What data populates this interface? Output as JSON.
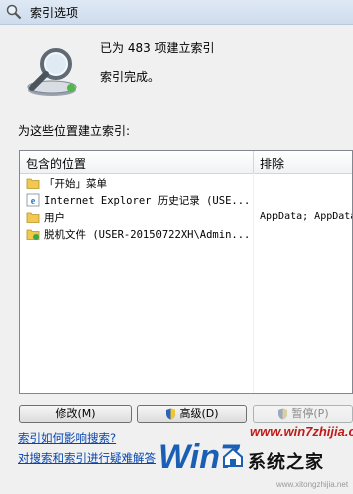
{
  "window": {
    "title": "索引选项"
  },
  "summary": {
    "count_text": "已为 483 项建立索引",
    "status_text": "索引完成。"
  },
  "locations": {
    "section_label": "为这些位置建立索引:",
    "columns": {
      "included": "包含的位置",
      "excluded": "排除"
    },
    "rows": [
      {
        "icon": "folder-icon",
        "location": "「开始」菜单",
        "exclude": ""
      },
      {
        "icon": "ie-history-icon",
        "location": "Internet Explorer 历史记录 (USE...",
        "exclude": ""
      },
      {
        "icon": "folder-icon",
        "location": "用户",
        "exclude": "AppData; AppData"
      },
      {
        "icon": "offline-files-icon",
        "location": "脱机文件 (USER-20150722XH\\Admin...",
        "exclude": ""
      }
    ]
  },
  "buttons": {
    "modify": "修改(M)",
    "advanced": "高级(D)",
    "pause": "暂停(P)"
  },
  "links": {
    "search_help": "索引如何影响搜索?",
    "troubleshoot": "对搜索和索引进行疑难解答"
  },
  "watermark": {
    "url": "www.win7zhijia.cn",
    "brand": "系统之家",
    "win": "Win7",
    "small": "www.xitongzhijia.net"
  },
  "colors": {
    "link": "#0645ad",
    "watermark_red": "#c21b17",
    "watermark_blue": "#1a5fb4"
  }
}
